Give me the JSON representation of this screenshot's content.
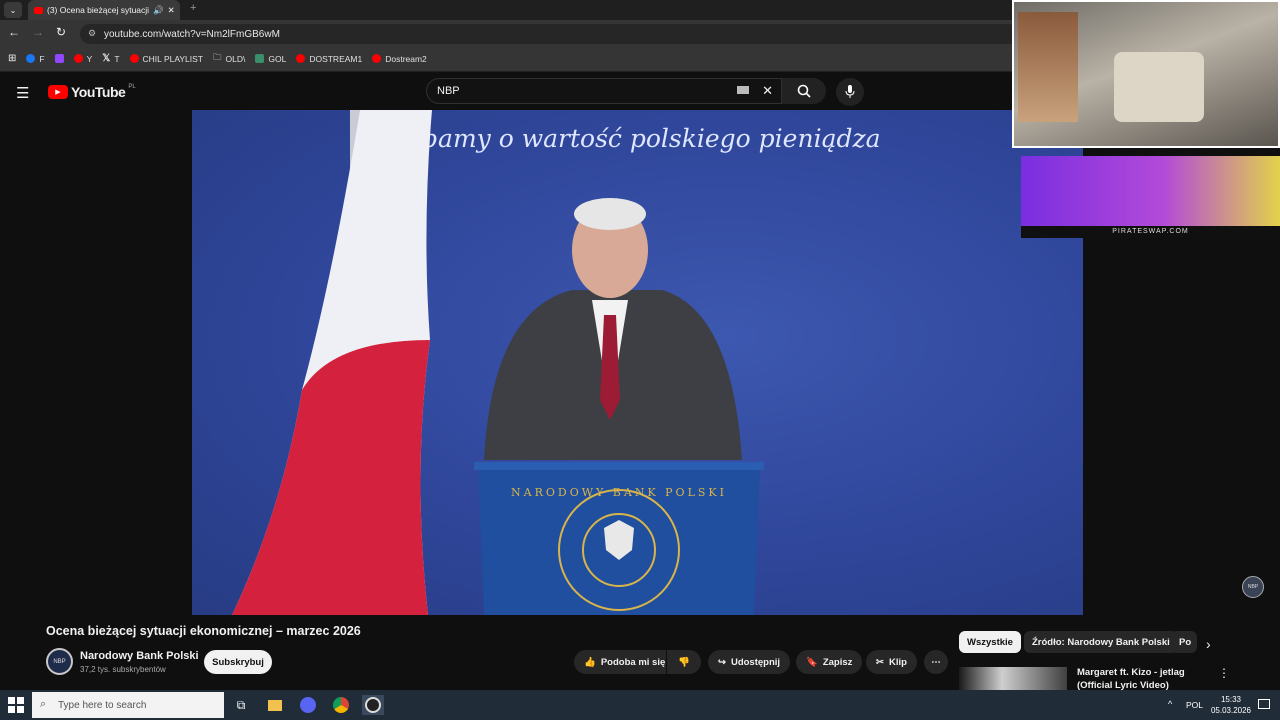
{
  "browser": {
    "tab_title": "(3) Ocena bieżącej sytuacji",
    "url": "youtube.com/watch?v=Nm2lFmGB6wM",
    "bookmarks": [
      "F",
      "Y",
      "T",
      "CHIL PLAYLIST",
      "OLD\\",
      "GOL",
      "DOSTREAM1",
      "Dostream2"
    ]
  },
  "youtube": {
    "logo": "YouTube",
    "region": "PL",
    "search_value": "NBP"
  },
  "video": {
    "banner_text": "Dbamy o wartość polskiego pieniądza",
    "lectern_text": "NARODOWY BANK POLSKI",
    "badge": "NBP",
    "title": "Ocena bieżącej sytuacji ekonomicznej – marzec 2026"
  },
  "channel": {
    "name": "Narodowy Bank Polski",
    "subscribers": "37,2 tys. subskrybentów",
    "avatar_text": "NBP",
    "subscribe_label": "Subskrybuj"
  },
  "actions": {
    "like": "Podoba mi się",
    "share": "Udostępnij",
    "save": "Zapisz",
    "clip": "Klip"
  },
  "chips": [
    "Wszystkie",
    "Źródło: Narodowy Bank Polski",
    "Po"
  ],
  "recommendation": {
    "title": "Margaret ft. Kizo - jetlag (Official Lyric Video)"
  },
  "ad": {
    "label": "PIRATESWAP.COM"
  },
  "taskbar": {
    "search_placeholder": "Type here to search",
    "lang": "POL",
    "time": "15:33",
    "date": "05.03.2026"
  },
  "colors": {
    "yt_red": "#ff0000",
    "video_bg": "#2f469a",
    "flag_red": "#d4213d"
  }
}
